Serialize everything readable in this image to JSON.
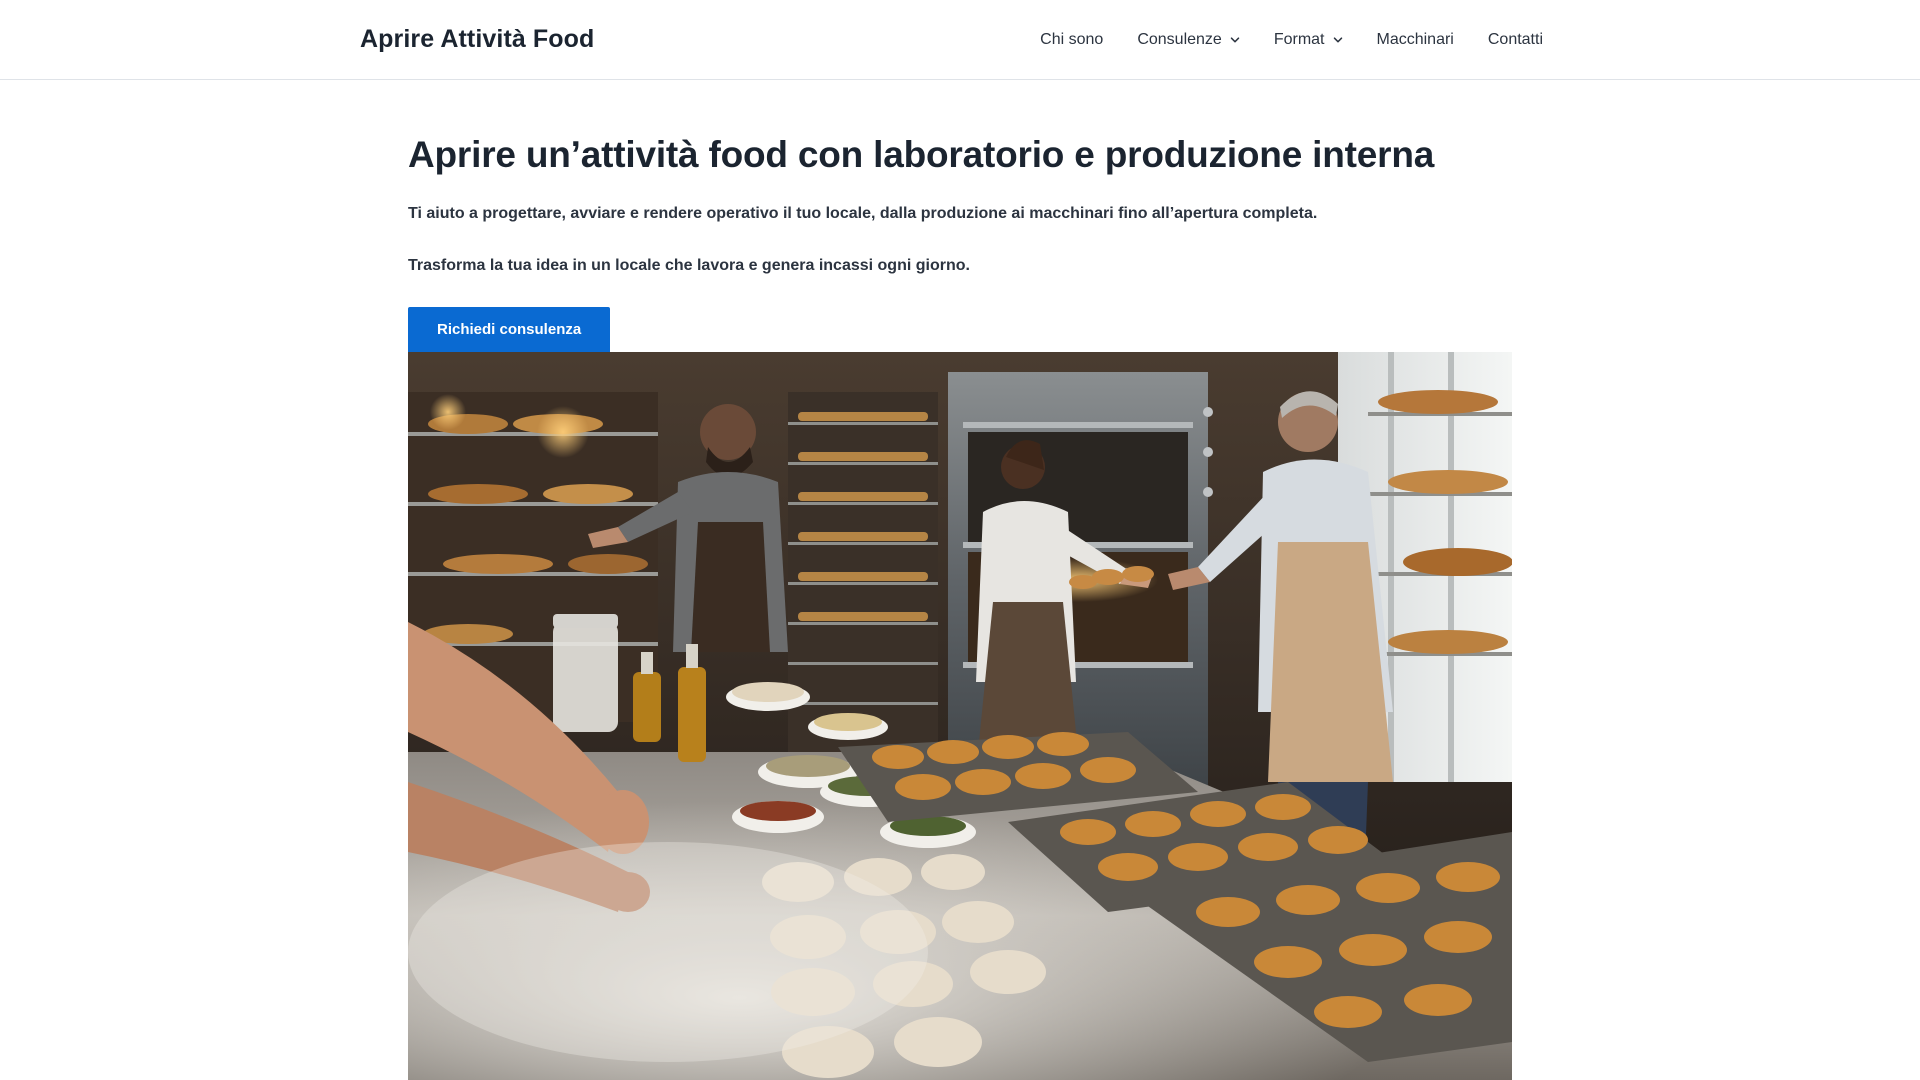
{
  "header": {
    "brand": "Aprire Attività Food",
    "nav": [
      {
        "label": "Chi sono",
        "has_dropdown": false
      },
      {
        "label": "Consulenze",
        "has_dropdown": true
      },
      {
        "label": "Format",
        "has_dropdown": true
      },
      {
        "label": "Macchinari",
        "has_dropdown": false
      },
      {
        "label": "Contatti",
        "has_dropdown": false
      }
    ]
  },
  "hero": {
    "title": "Aprire un’attività food con laboratorio e produzione interna",
    "lead_1": "Ti aiuto a progettare, avviare e rendere operativo il tuo locale, dalla produzione ai macchinari fino all’apertura completa.",
    "lead_2": "Trasforma la tua idea in un locale che lavora e genera incassi ogni giorno.",
    "cta_label": "Richiedi consulenza",
    "image_subject": "bakery-laboratory-photo"
  },
  "colors": {
    "accent": "#0a6ad2",
    "text": "#1b2430",
    "header_border": "#dfe3e8"
  },
  "icons": {
    "dropdown": "chevron-down-icon"
  }
}
